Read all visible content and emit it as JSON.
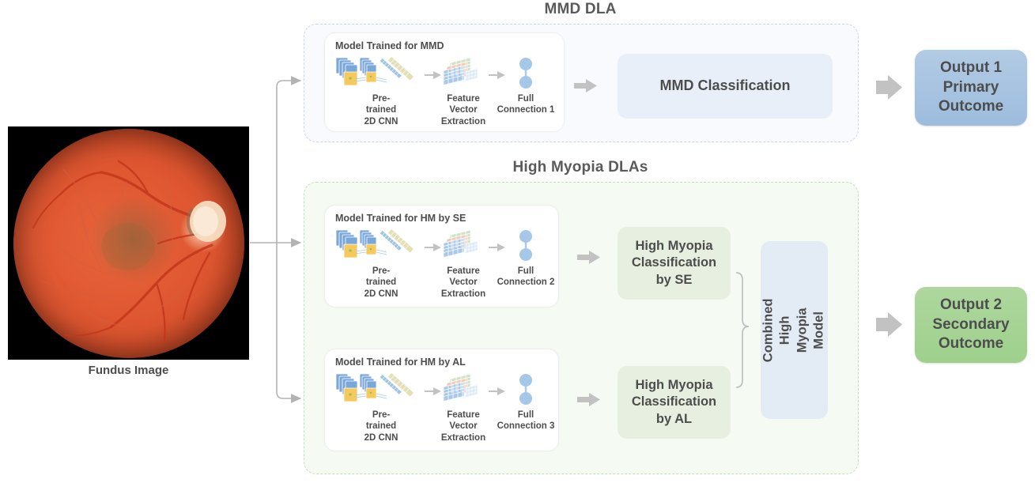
{
  "figure": {
    "fundus": {
      "caption": "Fundus Image",
      "alt_name": "retinal-fundus-photograph"
    },
    "sections": [
      {
        "id": "mmd",
        "title": "MMD DLA",
        "accent": "#c7d6ec",
        "background": "#f8fafd"
      },
      {
        "id": "high_myopia",
        "title": "High Myopia DLAs",
        "accent": "#c3dfb6",
        "background": "#f5faf2"
      }
    ],
    "model_cards": [
      {
        "id": "mmd",
        "title": "Model  Trained for MMD",
        "stages": [
          {
            "icon": "cnn-layer-stack-icon",
            "label": "Pre-\ntrained\n2D CNN"
          },
          {
            "icon": "feature-grid-icon",
            "label": "Feature\nVector\nExtraction"
          },
          {
            "icon": "fully-connected-nodes-icon",
            "label": "Full\nConnection 1"
          }
        ]
      },
      {
        "id": "hm_se",
        "title": "Model Trained for HM by SE",
        "stages": [
          {
            "icon": "cnn-layer-stack-icon",
            "label": "Pre-\ntrained\n2D CNN"
          },
          {
            "icon": "feature-grid-icon",
            "label": "Feature\nVector\nExtraction"
          },
          {
            "icon": "fully-connected-nodes-icon",
            "label": "Full\nConnection 2"
          }
        ]
      },
      {
        "id": "hm_al",
        "title": "Model Trained for HM by AL",
        "stages": [
          {
            "icon": "cnn-layer-stack-icon",
            "label": "Pre-\ntrained\n2D CNN"
          },
          {
            "icon": "feature-grid-icon",
            "label": "Feature\nVector\nExtraction"
          },
          {
            "icon": "fully-connected-nodes-icon",
            "label": "Full\nConnection 3"
          }
        ]
      }
    ],
    "result_boxes": {
      "mmd_classification": "MMD Classification",
      "hm_classification_se": "High Myopia\nClassification\nby SE",
      "hm_classification_al": "High Myopia\nClassification\nby AL",
      "combined_model": "Combined High\nMyopia Model"
    },
    "outputs": [
      {
        "id": "output-1",
        "text": "Output 1\nPrimary\nOutcome",
        "color": "#a4c2e0"
      },
      {
        "id": "output-2",
        "text": "Output 2\nSecondary\nOutcome",
        "color": "#a6d495"
      }
    ],
    "colors": {
      "text": "#4d4d4d",
      "title_text": "#5a5a5a",
      "arrow": "#b3b3b3",
      "mmd_panel": "#f8fafd",
      "mmd_panel_border": "#c7d6ec",
      "hm_panel": "#f5faf2",
      "hm_panel_border": "#c3dfb6",
      "mmd_result": "#e9eff8",
      "hm_result": "#e7f0e0",
      "combined_result": "#e3ecf5",
      "output_1": "#a4c2e0",
      "output_2": "#a6d495",
      "cnn_blue": "#6b9bd2",
      "cnn_yellow": "#f5c242"
    }
  }
}
